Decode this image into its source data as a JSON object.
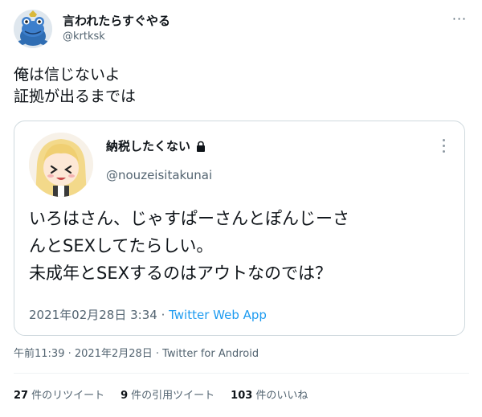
{
  "author": {
    "display_name": "言われたらすぐやる",
    "handle": "@krtksk",
    "avatar_icon": "frog-character-avatar"
  },
  "tweet": {
    "lines": [
      "俺は信じないよ",
      "証拠が出るまでは"
    ],
    "timestamp": "午前11:39 · 2021年2月28日 · Twitter for Android"
  },
  "quoted": {
    "display_name": "納税したくない",
    "handle": "@nouzeisitakunai",
    "avatar_icon": "anime-girl-avatar",
    "lock_icon": "lock-icon",
    "lines": [
      "いろはさん、じゃすぱーさんとぽんじーさ",
      "んとSEXしてたらしい。",
      "未成年とSEXするのはアウトなのでは？"
    ],
    "date": "2021年02月28日 3:34 · ",
    "source": "Twitter Web App"
  },
  "stats": {
    "retweets_count": "27",
    "retweets_label": "件のリツイート",
    "quotes_count": "9",
    "quotes_label": "件の引用ツイート",
    "likes_count": "103",
    "likes_label": "件のいいね"
  },
  "colors": {
    "text": "#0f1419",
    "secondary": "#536471",
    "link": "#1d9bf0",
    "border": "#cfd9de"
  }
}
